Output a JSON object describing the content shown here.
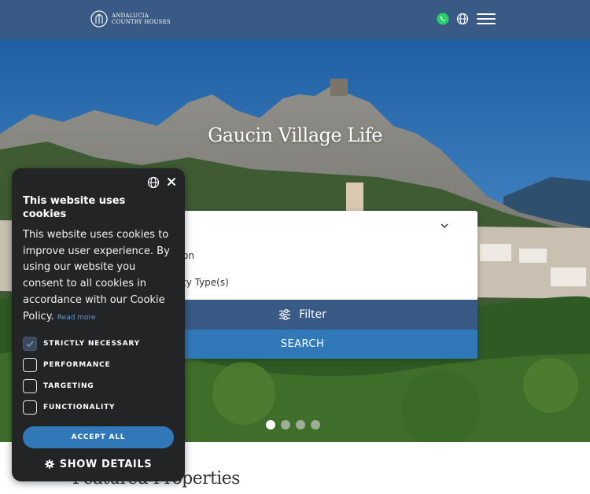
{
  "header": {
    "logo_line1": "ANDALUCIA",
    "logo_line2": "COUNTRY HOUSES",
    "icons": [
      "whatsapp-icon",
      "globe-icon",
      "hamburger-menu-icon"
    ]
  },
  "hero": {
    "title": "Gaucin Village Life",
    "slides": 4,
    "active_slide": 1
  },
  "search": {
    "location_label": "on",
    "type_label": "ty Type(s)",
    "filter_label": "Filter",
    "search_label": "SEARCH"
  },
  "featured": {
    "title": "Featured Properties"
  },
  "cookie": {
    "title": "This website uses cookies",
    "body": "This website uses cookies to improve user experience. By using our website you consent to all cookies in accordance with our Cookie Policy.",
    "read_more": "Read more",
    "options": [
      {
        "label": "STRICTLY NECESSARY",
        "checked": true
      },
      {
        "label": "PERFORMANCE",
        "checked": false
      },
      {
        "label": "TARGETING",
        "checked": false
      },
      {
        "label": "FUNCTIONALITY",
        "checked": false
      }
    ],
    "accept_label": "ACCEPT ALL",
    "details_label": "SHOW DETAILS"
  },
  "colors": {
    "header_bg": "#3a5a86",
    "filter_bg": "#3a5a86",
    "search_bg": "#3178b8",
    "cookie_bg": "#232425",
    "link": "#5b9bd5"
  }
}
